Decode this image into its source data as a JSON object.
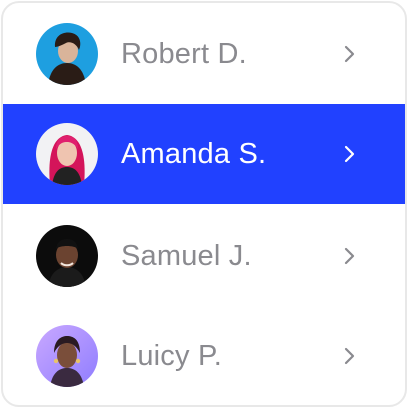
{
  "people": [
    {
      "name": "Robert D.",
      "selected": false,
      "avatar_icon": "person-avatar-icon"
    },
    {
      "name": "Amanda S.",
      "selected": true,
      "avatar_icon": "person-avatar-icon"
    },
    {
      "name": "Samuel J.",
      "selected": false,
      "avatar_icon": "person-avatar-icon"
    },
    {
      "name": "Luicy P.",
      "selected": false,
      "avatar_icon": "person-avatar-icon"
    }
  ],
  "colors": {
    "accent": "#2141ff",
    "name_text": "#8a8a8f",
    "selected_text": "#ffffff",
    "card_border": "#e8e8e8"
  }
}
